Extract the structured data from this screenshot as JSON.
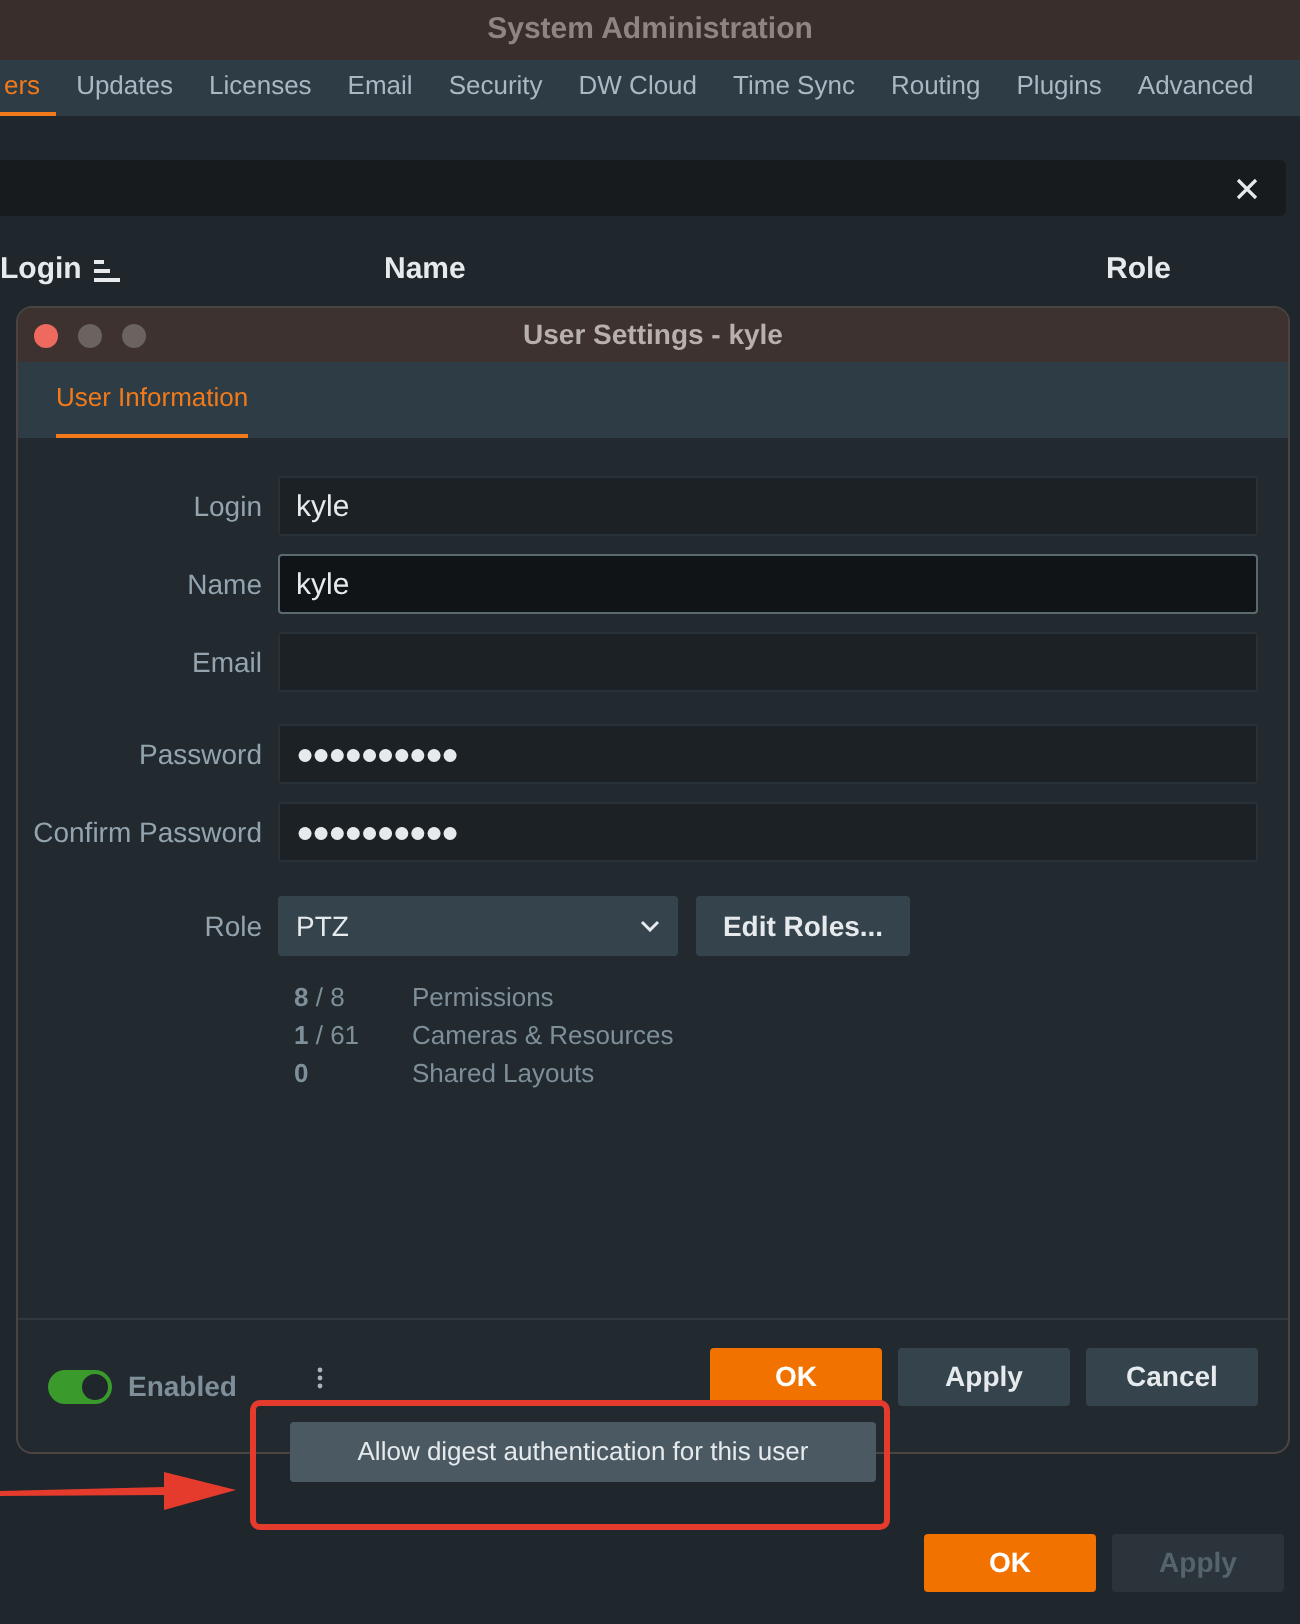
{
  "window": {
    "title": "System Administration"
  },
  "tabs": [
    {
      "label": "ers",
      "selected": true
    },
    {
      "label": "Updates",
      "selected": false
    },
    {
      "label": "Licenses",
      "selected": false
    },
    {
      "label": "Email",
      "selected": false
    },
    {
      "label": "Security",
      "selected": false
    },
    {
      "label": "DW Cloud",
      "selected": false
    },
    {
      "label": "Time Sync",
      "selected": false
    },
    {
      "label": "Routing",
      "selected": false
    },
    {
      "label": "Plugins",
      "selected": false
    },
    {
      "label": "Advanced",
      "selected": false
    }
  ],
  "table": {
    "columns": [
      {
        "label": "Login",
        "sorted": true
      },
      {
        "label": "Name",
        "sorted": false
      },
      {
        "label": "Role",
        "sorted": false
      }
    ]
  },
  "dialog": {
    "title": "User Settings - kyle",
    "tabs": [
      {
        "label": "User Information",
        "selected": true
      }
    ],
    "field_groups": [
      [
        {
          "label": "Login",
          "value": "kyle",
          "focused": false
        },
        {
          "label": "Name",
          "value": "kyle",
          "focused": true
        },
        {
          "label": "Email",
          "focused": false
        }
      ],
      [
        {
          "label": "Password",
          "value": "●●●●●●●●●●",
          "focused": false
        },
        {
          "label": "Confirm Password",
          "value": "●●●●●●●●●●",
          "focused": false
        }
      ]
    ],
    "role": {
      "label": "Role",
      "value": "PTZ"
    },
    "edit_roles": "Edit Roles...",
    "stats": [
      {
        "count": "**8** / 8",
        "label": "Permissions"
      },
      {
        "count": "**1** / 61",
        "label": "Cameras & Resources"
      },
      {
        "count": "**0**",
        "label": "Shared Layouts"
      }
    ],
    "enabled": {
      "label": "Enabled",
      "on": true
    },
    "buttons": [
      {
        "label": "OK",
        "kind": "primary"
      },
      {
        "label": "Apply",
        "kind": "secondary"
      },
      {
        "label": "Cancel",
        "kind": "secondary"
      }
    ],
    "menu": [
      {
        "label": "Allow digest authentication for this user"
      }
    ]
  },
  "buttons": [
    {
      "label": "OK",
      "kind": "primary",
      "disabled": false
    },
    {
      "label": "Apply",
      "kind": "secondary",
      "disabled": true
    }
  ]
}
